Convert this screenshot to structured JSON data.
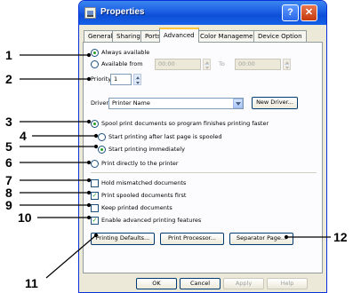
{
  "window": {
    "title": "Properties",
    "help_glyph": "?",
    "close_glyph": "✕"
  },
  "tabs": [
    "General",
    "Sharing",
    "Ports",
    "Advanced",
    "Color Management",
    "Device Option"
  ],
  "active_tab": "Advanced",
  "availability": {
    "always_label": "Always available",
    "from_label": "Available from",
    "from_value": "00:00",
    "to_label": "To",
    "to_value": "00:00",
    "selected": "always"
  },
  "priority": {
    "label": "Priority:",
    "value": "1"
  },
  "driver": {
    "label": "Driver:",
    "value": "Printer Name",
    "new_button": "New Driver..."
  },
  "spooling": {
    "spool_label": "Spool print documents so program finishes printing faster",
    "after_last_page_label": "Start printing after last page is spooled",
    "immediately_label": "Start printing immediately",
    "direct_label": "Print directly to the printer",
    "selected_mode": "spool",
    "selected_start": "immediately"
  },
  "options": [
    {
      "label": "Hold mismatched documents",
      "checked": false
    },
    {
      "label": "Print spooled documents first",
      "checked": true
    },
    {
      "label": "Keep printed documents",
      "checked": false
    },
    {
      "label": "Enable advanced printing features",
      "checked": true
    }
  ],
  "buttons": {
    "printing_defaults": "Printing Defaults...",
    "print_processor": "Print Processor...",
    "separator_page": "Separator Page...",
    "ok": "OK",
    "cancel": "Cancel",
    "apply": "Apply",
    "help": "Help"
  },
  "callouts": [
    "1",
    "2",
    "3",
    "4",
    "5",
    "6",
    "7",
    "8",
    "9",
    "10",
    "11",
    "12"
  ],
  "check_glyph": "✓"
}
